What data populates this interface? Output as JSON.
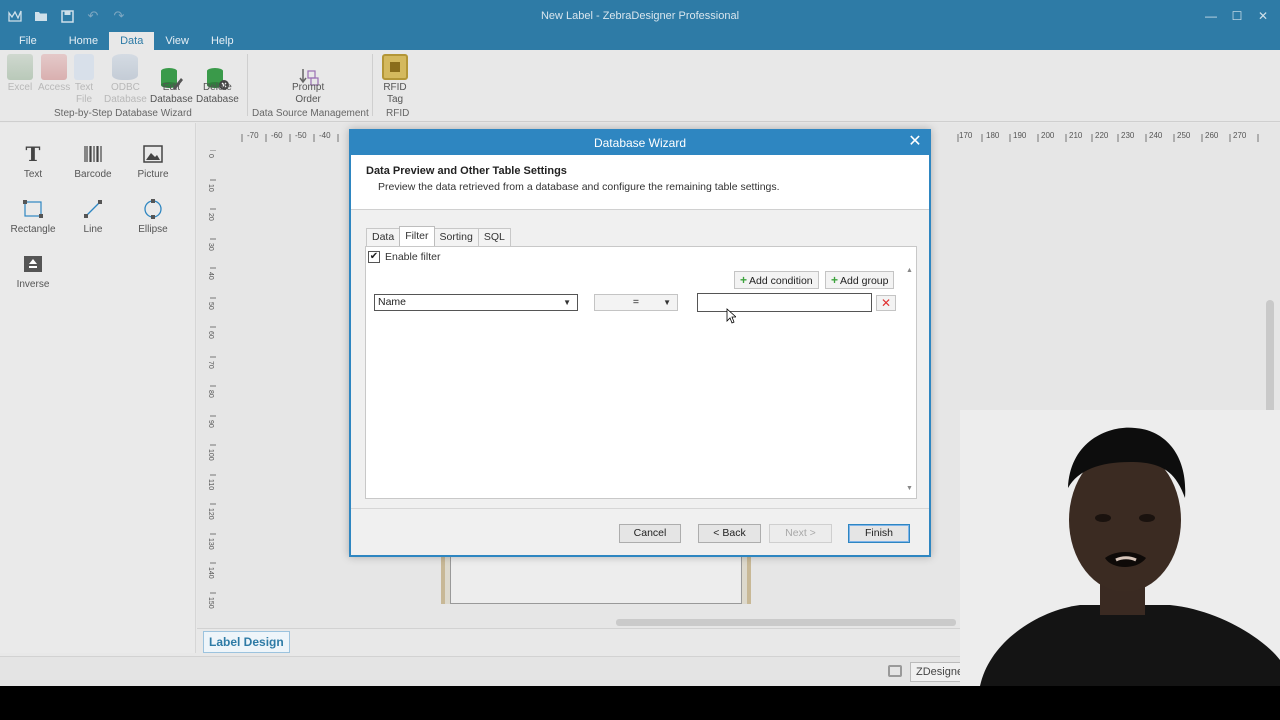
{
  "window": {
    "title": "New Label - ZebraDesigner Professional"
  },
  "menu": [
    {
      "label": "File"
    },
    {
      "label": "Home"
    },
    {
      "label": "Data",
      "active": true
    },
    {
      "label": "View"
    },
    {
      "label": "Help"
    }
  ],
  "ribbon": {
    "buttons": [
      {
        "label": "Excel",
        "icon": "excel-icon",
        "enabled": false
      },
      {
        "label": "Access",
        "icon": "access-icon",
        "enabled": false
      },
      {
        "label": "Text\nFile",
        "icon": "text-file-icon",
        "enabled": false
      },
      {
        "label": "ODBC\nDatabase",
        "icon": "odbc-icon",
        "enabled": false
      },
      {
        "label": "Edit\nDatabase",
        "icon": "edit-database-icon",
        "enabled": true
      },
      {
        "label": "Delete\nDatabase",
        "icon": "delete-database-icon",
        "enabled": true
      },
      {
        "label": "Prompt\nOrder",
        "icon": "prompt-order-icon",
        "enabled": true
      },
      {
        "label": "RFID\nTag",
        "icon": "rfid-tag-icon",
        "enabled": true
      }
    ],
    "groups": [
      "Step-by-Step Database Wizard",
      "Data Source Management",
      "RFID"
    ]
  },
  "toolbox": [
    {
      "label": "Text",
      "icon": "text-tool-icon"
    },
    {
      "label": "Barcode",
      "icon": "barcode-icon"
    },
    {
      "label": "Picture",
      "icon": "picture-icon"
    },
    {
      "label": "Rectangle",
      "icon": "rectangle-icon"
    },
    {
      "label": "Line",
      "icon": "line-icon"
    },
    {
      "label": "Ellipse",
      "icon": "ellipse-icon"
    },
    {
      "label": "Inverse",
      "icon": "inverse-icon"
    }
  ],
  "ruler": {
    "top_left": [
      "-70",
      "-60",
      "-50",
      "-40"
    ],
    "top_right": [
      "170",
      "180",
      "190",
      "200",
      "210",
      "220",
      "230",
      "240",
      "250",
      "260",
      "270"
    ],
    "left": [
      "0",
      "10",
      "20",
      "30",
      "40",
      "50",
      "60",
      "70",
      "80",
      "90",
      "100",
      "110",
      "120",
      "130",
      "140",
      "150"
    ]
  },
  "bottom_tab": "Label Design",
  "status": {
    "printer": "ZDesigner Z"
  },
  "dialog": {
    "title": "Database Wizard",
    "header_title": "Data Preview and Other Table Settings",
    "header_desc": "Preview the data retrieved from a database and configure the remaining table settings.",
    "tabs": [
      {
        "label": "Data"
      },
      {
        "label": "Filter",
        "active": true
      },
      {
        "label": "Sorting"
      },
      {
        "label": "SQL"
      }
    ],
    "enable_filter": {
      "label": "Enable filter",
      "checked": true,
      "check": "✔"
    },
    "add_condition": "Add condition",
    "add_group": "Add group",
    "condition": {
      "field": "Name",
      "operator": "=",
      "value": ""
    },
    "buttons": {
      "cancel": "Cancel",
      "back": "< Back",
      "next": "Next >",
      "finish": "Finish"
    }
  },
  "colors": {
    "accent": "#2e7ba6",
    "dialog_accent": "#2e86c1",
    "delete_red": "#e03030",
    "add_green": "#3da33d"
  }
}
